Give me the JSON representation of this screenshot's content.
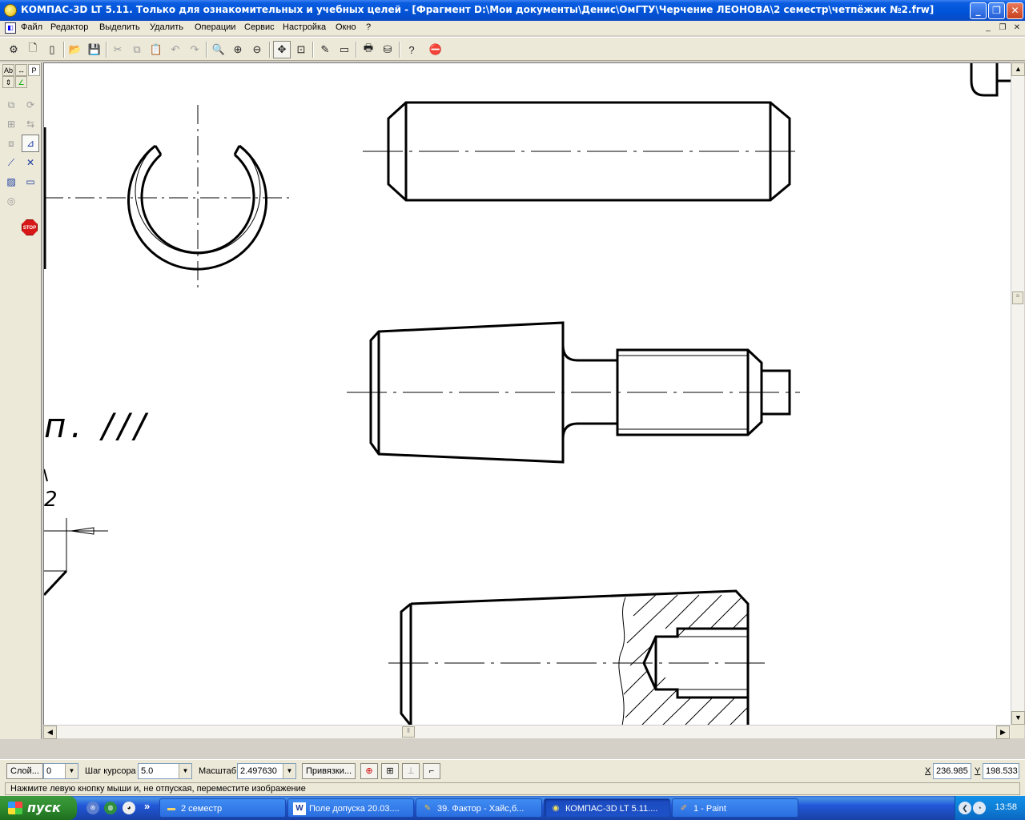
{
  "window": {
    "title": "КОМПАС-3D LT 5.11. Только для ознакомительных и учебных целей - [Фрагмент D:\\Мои документы\\Денис\\ОмГТУ\\Черчение ЛЕОНОВА\\2 семестр\\четпёжик №2.frw]",
    "btn_minimize": "_",
    "btn_restore": "❐",
    "btn_close": "✕"
  },
  "menu": {
    "items": [
      "Файл",
      "Редактор",
      "Выделить",
      "Удалить",
      "Операции",
      "Сервис",
      "Настройка",
      "Окно",
      "?"
    ],
    "mdi_minimize": "_",
    "mdi_restore": "❐",
    "mdi_close": "✕"
  },
  "toolbar_icons": [
    "new-icon",
    "open-icon",
    "save-icon",
    "cut-icon",
    "copy-icon",
    "paste-icon",
    "undo-icon",
    "redo-icon",
    "zoom-icon",
    "pan-icon",
    "help-icon"
  ],
  "drawing": {
    "text_fragment_1": "п. ///",
    "text_fragment_2": "2"
  },
  "params": {
    "layer_button": "Слой...",
    "layer_value": "0",
    "step_label": "Шаг курсора",
    "step_value": "5.0",
    "scale_label": "Масштаб",
    "scale_value": "2.497630",
    "snap_button": "Привязки...",
    "x_label": "X",
    "x_value": "236.985",
    "y_label": "Y",
    "y_value": "198.533"
  },
  "hint": "Нажмите левую кнопку мыши и, не отпуская, переместите изображение",
  "taskbar": {
    "start_label": "пуск",
    "quicklaunch_more": "»",
    "tasks": [
      {
        "label": "2 семестр",
        "icon": "folder-icon"
      },
      {
        "label": "Поле допуска 20.03....",
        "icon": "word-icon"
      },
      {
        "label": "39. Фактор - Хайс,б...",
        "icon": "media-icon"
      },
      {
        "label": "КОМПАС-3D LT 5.11....",
        "icon": "kompas-icon"
      },
      {
        "label": "1 - Paint",
        "icon": "paint-icon"
      }
    ],
    "clock": "13:58"
  }
}
